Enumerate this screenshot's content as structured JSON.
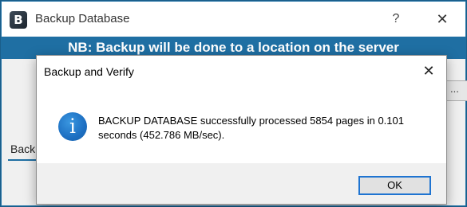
{
  "back_window": {
    "title": "Backup Database",
    "icon": "B",
    "help_glyph": "?",
    "close_glyph": "✕",
    "banner": "NB: Backup will be done to a location on the server",
    "field_fragment": "...",
    "tab_label": "Backu"
  },
  "dialog": {
    "title": "Backup and Verify",
    "close_glyph": "✕",
    "icon": "info-icon",
    "message": "BACKUP DATABASE successfully processed 5854 pages in 0.101 seconds (452.786 MB/sec).",
    "ok_label": "OK"
  },
  "colors": {
    "banner_blue": "#1f6fa3",
    "info_blue": "#1d6fc2",
    "ok_border": "#1f74d1"
  }
}
